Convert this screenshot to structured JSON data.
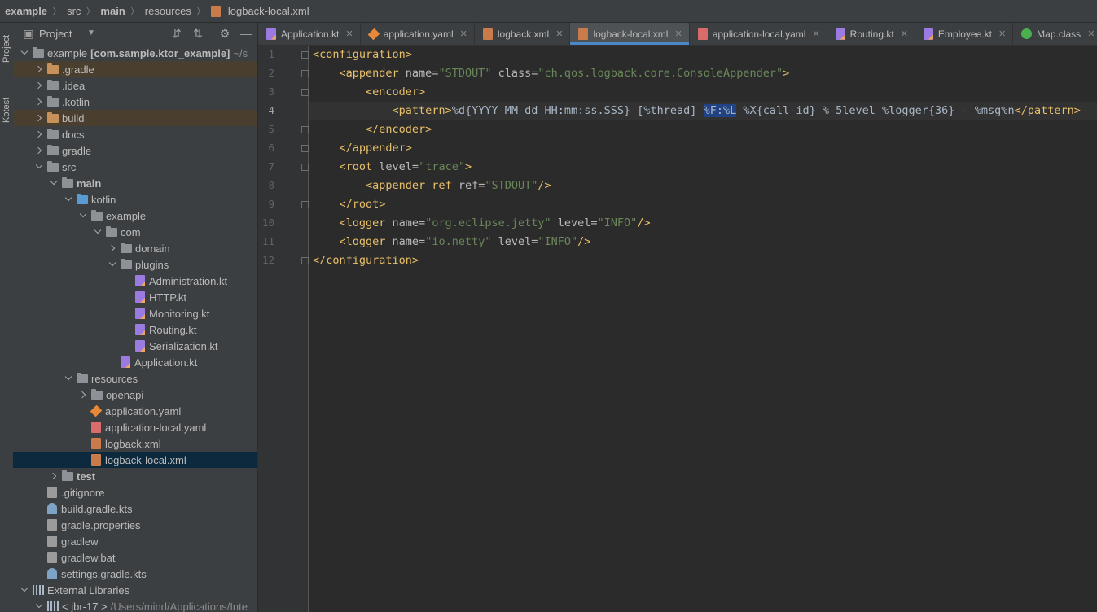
{
  "breadcrumb": [
    "example",
    "src",
    "main",
    "resources",
    "logback-local.xml"
  ],
  "tool_strip": {
    "project": "Project",
    "kotest": "Kotest"
  },
  "project_panel": {
    "title": "Project",
    "tree": [
      {
        "label": "example",
        "suffix": "[com.sample.ktor_example]",
        "extra": "~/s",
        "depth": 0,
        "chevron": "down",
        "icon": "module-folder"
      },
      {
        "label": ".gradle",
        "depth": 1,
        "chevron": "right",
        "icon": "folder-orange",
        "highlight": true
      },
      {
        "label": ".idea",
        "depth": 1,
        "chevron": "right",
        "icon": "folder"
      },
      {
        "label": ".kotlin",
        "depth": 1,
        "chevron": "right",
        "icon": "folder"
      },
      {
        "label": "build",
        "depth": 1,
        "chevron": "right",
        "icon": "folder-orange",
        "highlight": true
      },
      {
        "label": "docs",
        "depth": 1,
        "chevron": "right",
        "icon": "folder"
      },
      {
        "label": "gradle",
        "depth": 1,
        "chevron": "right",
        "icon": "folder"
      },
      {
        "label": "src",
        "depth": 1,
        "chevron": "down",
        "icon": "folder"
      },
      {
        "label": "main",
        "depth": 2,
        "chevron": "down",
        "icon": "folder",
        "bold": true
      },
      {
        "label": "kotlin",
        "depth": 3,
        "chevron": "down",
        "icon": "folder-blue"
      },
      {
        "label": "example",
        "depth": 4,
        "chevron": "down",
        "icon": "package"
      },
      {
        "label": "com",
        "depth": 5,
        "chevron": "down",
        "icon": "package"
      },
      {
        "label": "domain",
        "depth": 6,
        "chevron": "right",
        "icon": "package"
      },
      {
        "label": "plugins",
        "depth": 6,
        "chevron": "down",
        "icon": "package"
      },
      {
        "label": "Administration.kt",
        "depth": 7,
        "icon": "kt"
      },
      {
        "label": "HTTP.kt",
        "depth": 7,
        "icon": "kt"
      },
      {
        "label": "Monitoring.kt",
        "depth": 7,
        "icon": "kt"
      },
      {
        "label": "Routing.kt",
        "depth": 7,
        "icon": "kt"
      },
      {
        "label": "Serialization.kt",
        "depth": 7,
        "icon": "kt"
      },
      {
        "label": "Application.kt",
        "depth": 6,
        "icon": "kt"
      },
      {
        "label": "resources",
        "depth": 3,
        "chevron": "down",
        "icon": "folder-res"
      },
      {
        "label": "openapi",
        "depth": 4,
        "chevron": "right",
        "icon": "folder"
      },
      {
        "label": "application.yaml",
        "depth": 4,
        "icon": "yaml"
      },
      {
        "label": "application-local.yaml",
        "depth": 4,
        "icon": "yml"
      },
      {
        "label": "logback.xml",
        "depth": 4,
        "icon": "xml"
      },
      {
        "label": "logback-local.xml",
        "depth": 4,
        "icon": "xml",
        "selected": true
      },
      {
        "label": "test",
        "depth": 2,
        "chevron": "right",
        "icon": "folder",
        "bold": true
      },
      {
        "label": ".gitignore",
        "depth": 1,
        "icon": "generic"
      },
      {
        "label": "build.gradle.kts",
        "depth": 1,
        "icon": "gradle"
      },
      {
        "label": "gradle.properties",
        "depth": 1,
        "icon": "generic"
      },
      {
        "label": "gradlew",
        "depth": 1,
        "icon": "generic"
      },
      {
        "label": "gradlew.bat",
        "depth": 1,
        "icon": "generic"
      },
      {
        "label": "settings.gradle.kts",
        "depth": 1,
        "icon": "gradle"
      },
      {
        "label": "External Libraries",
        "depth": 0,
        "chevron": "down",
        "icon": "library"
      },
      {
        "label": "< jbr-17 >",
        "suffix_dim": "/Users/mind/Applications/Inte",
        "depth": 1,
        "chevron": "down",
        "icon": "library"
      }
    ]
  },
  "tabs": [
    {
      "label": "Application.kt",
      "icon": "kt"
    },
    {
      "label": "application.yaml",
      "icon": "yaml"
    },
    {
      "label": "logback.xml",
      "icon": "xml"
    },
    {
      "label": "logback-local.xml",
      "icon": "xml",
      "active": true
    },
    {
      "label": "application-local.yaml",
      "icon": "yml"
    },
    {
      "label": "Routing.kt",
      "icon": "kt"
    },
    {
      "label": "Employee.kt",
      "icon": "kt"
    },
    {
      "label": "Map.class",
      "icon": "class"
    }
  ],
  "editor": {
    "current_line": 4,
    "lines": [
      {
        "n": "1",
        "fold": true,
        "tokens": [
          [
            "tg",
            "<configuration>"
          ]
        ]
      },
      {
        "n": "2",
        "fold": true,
        "tokens": [
          [
            "tx",
            "    "
          ],
          [
            "tg",
            "<appender "
          ],
          [
            "at",
            "name="
          ],
          [
            "av",
            "\"STDOUT\""
          ],
          [
            "at",
            " class="
          ],
          [
            "av",
            "\"ch.qos.logback.core.ConsoleAppender\""
          ],
          [
            "tg",
            ">"
          ]
        ]
      },
      {
        "n": "3",
        "fold": true,
        "tokens": [
          [
            "tx",
            "        "
          ],
          [
            "tg",
            "<encoder>"
          ]
        ]
      },
      {
        "n": "4",
        "fold": false,
        "bulb": true,
        "tokens": [
          [
            "tx",
            "            "
          ],
          [
            "tg",
            "<pattern>"
          ],
          [
            "tx",
            "%d{YYYY-MM-dd HH:mm:ss.SSS} [%thread] "
          ],
          [
            "sel",
            "%F:%L"
          ],
          [
            "tx",
            " %X{call-id} %-5level %logger{36} - %msg%n"
          ],
          [
            "tg",
            "</pattern>"
          ]
        ]
      },
      {
        "n": "5",
        "fold": true,
        "tokens": [
          [
            "tx",
            "        "
          ],
          [
            "tg",
            "</encoder>"
          ]
        ]
      },
      {
        "n": "6",
        "fold": true,
        "tokens": [
          [
            "tx",
            "    "
          ],
          [
            "tg",
            "</appender>"
          ]
        ]
      },
      {
        "n": "7",
        "fold": true,
        "tokens": [
          [
            "tx",
            "    "
          ],
          [
            "tg",
            "<root "
          ],
          [
            "at",
            "level="
          ],
          [
            "av",
            "\"trace\""
          ],
          [
            "tg",
            ">"
          ]
        ]
      },
      {
        "n": "8",
        "fold": false,
        "tokens": [
          [
            "tx",
            "        "
          ],
          [
            "tg",
            "<appender-ref "
          ],
          [
            "at",
            "ref="
          ],
          [
            "av",
            "\"STDOUT\""
          ],
          [
            "tg",
            "/>"
          ]
        ]
      },
      {
        "n": "9",
        "fold": true,
        "tokens": [
          [
            "tx",
            "    "
          ],
          [
            "tg",
            "</root>"
          ]
        ]
      },
      {
        "n": "10",
        "fold": false,
        "tokens": [
          [
            "tx",
            "    "
          ],
          [
            "tg",
            "<logger "
          ],
          [
            "at",
            "name="
          ],
          [
            "av",
            "\"org.eclipse.jetty\""
          ],
          [
            "at",
            " level="
          ],
          [
            "av",
            "\"INFO\""
          ],
          [
            "tg",
            "/>"
          ]
        ]
      },
      {
        "n": "11",
        "fold": false,
        "tokens": [
          [
            "tx",
            "    "
          ],
          [
            "tg",
            "<logger "
          ],
          [
            "at",
            "name="
          ],
          [
            "av",
            "\"io.netty\""
          ],
          [
            "at",
            " level="
          ],
          [
            "av",
            "\"INFO\""
          ],
          [
            "tg",
            "/>"
          ]
        ]
      },
      {
        "n": "12",
        "fold": true,
        "tokens": [
          [
            "tg",
            "</configuration>"
          ]
        ]
      }
    ]
  }
}
